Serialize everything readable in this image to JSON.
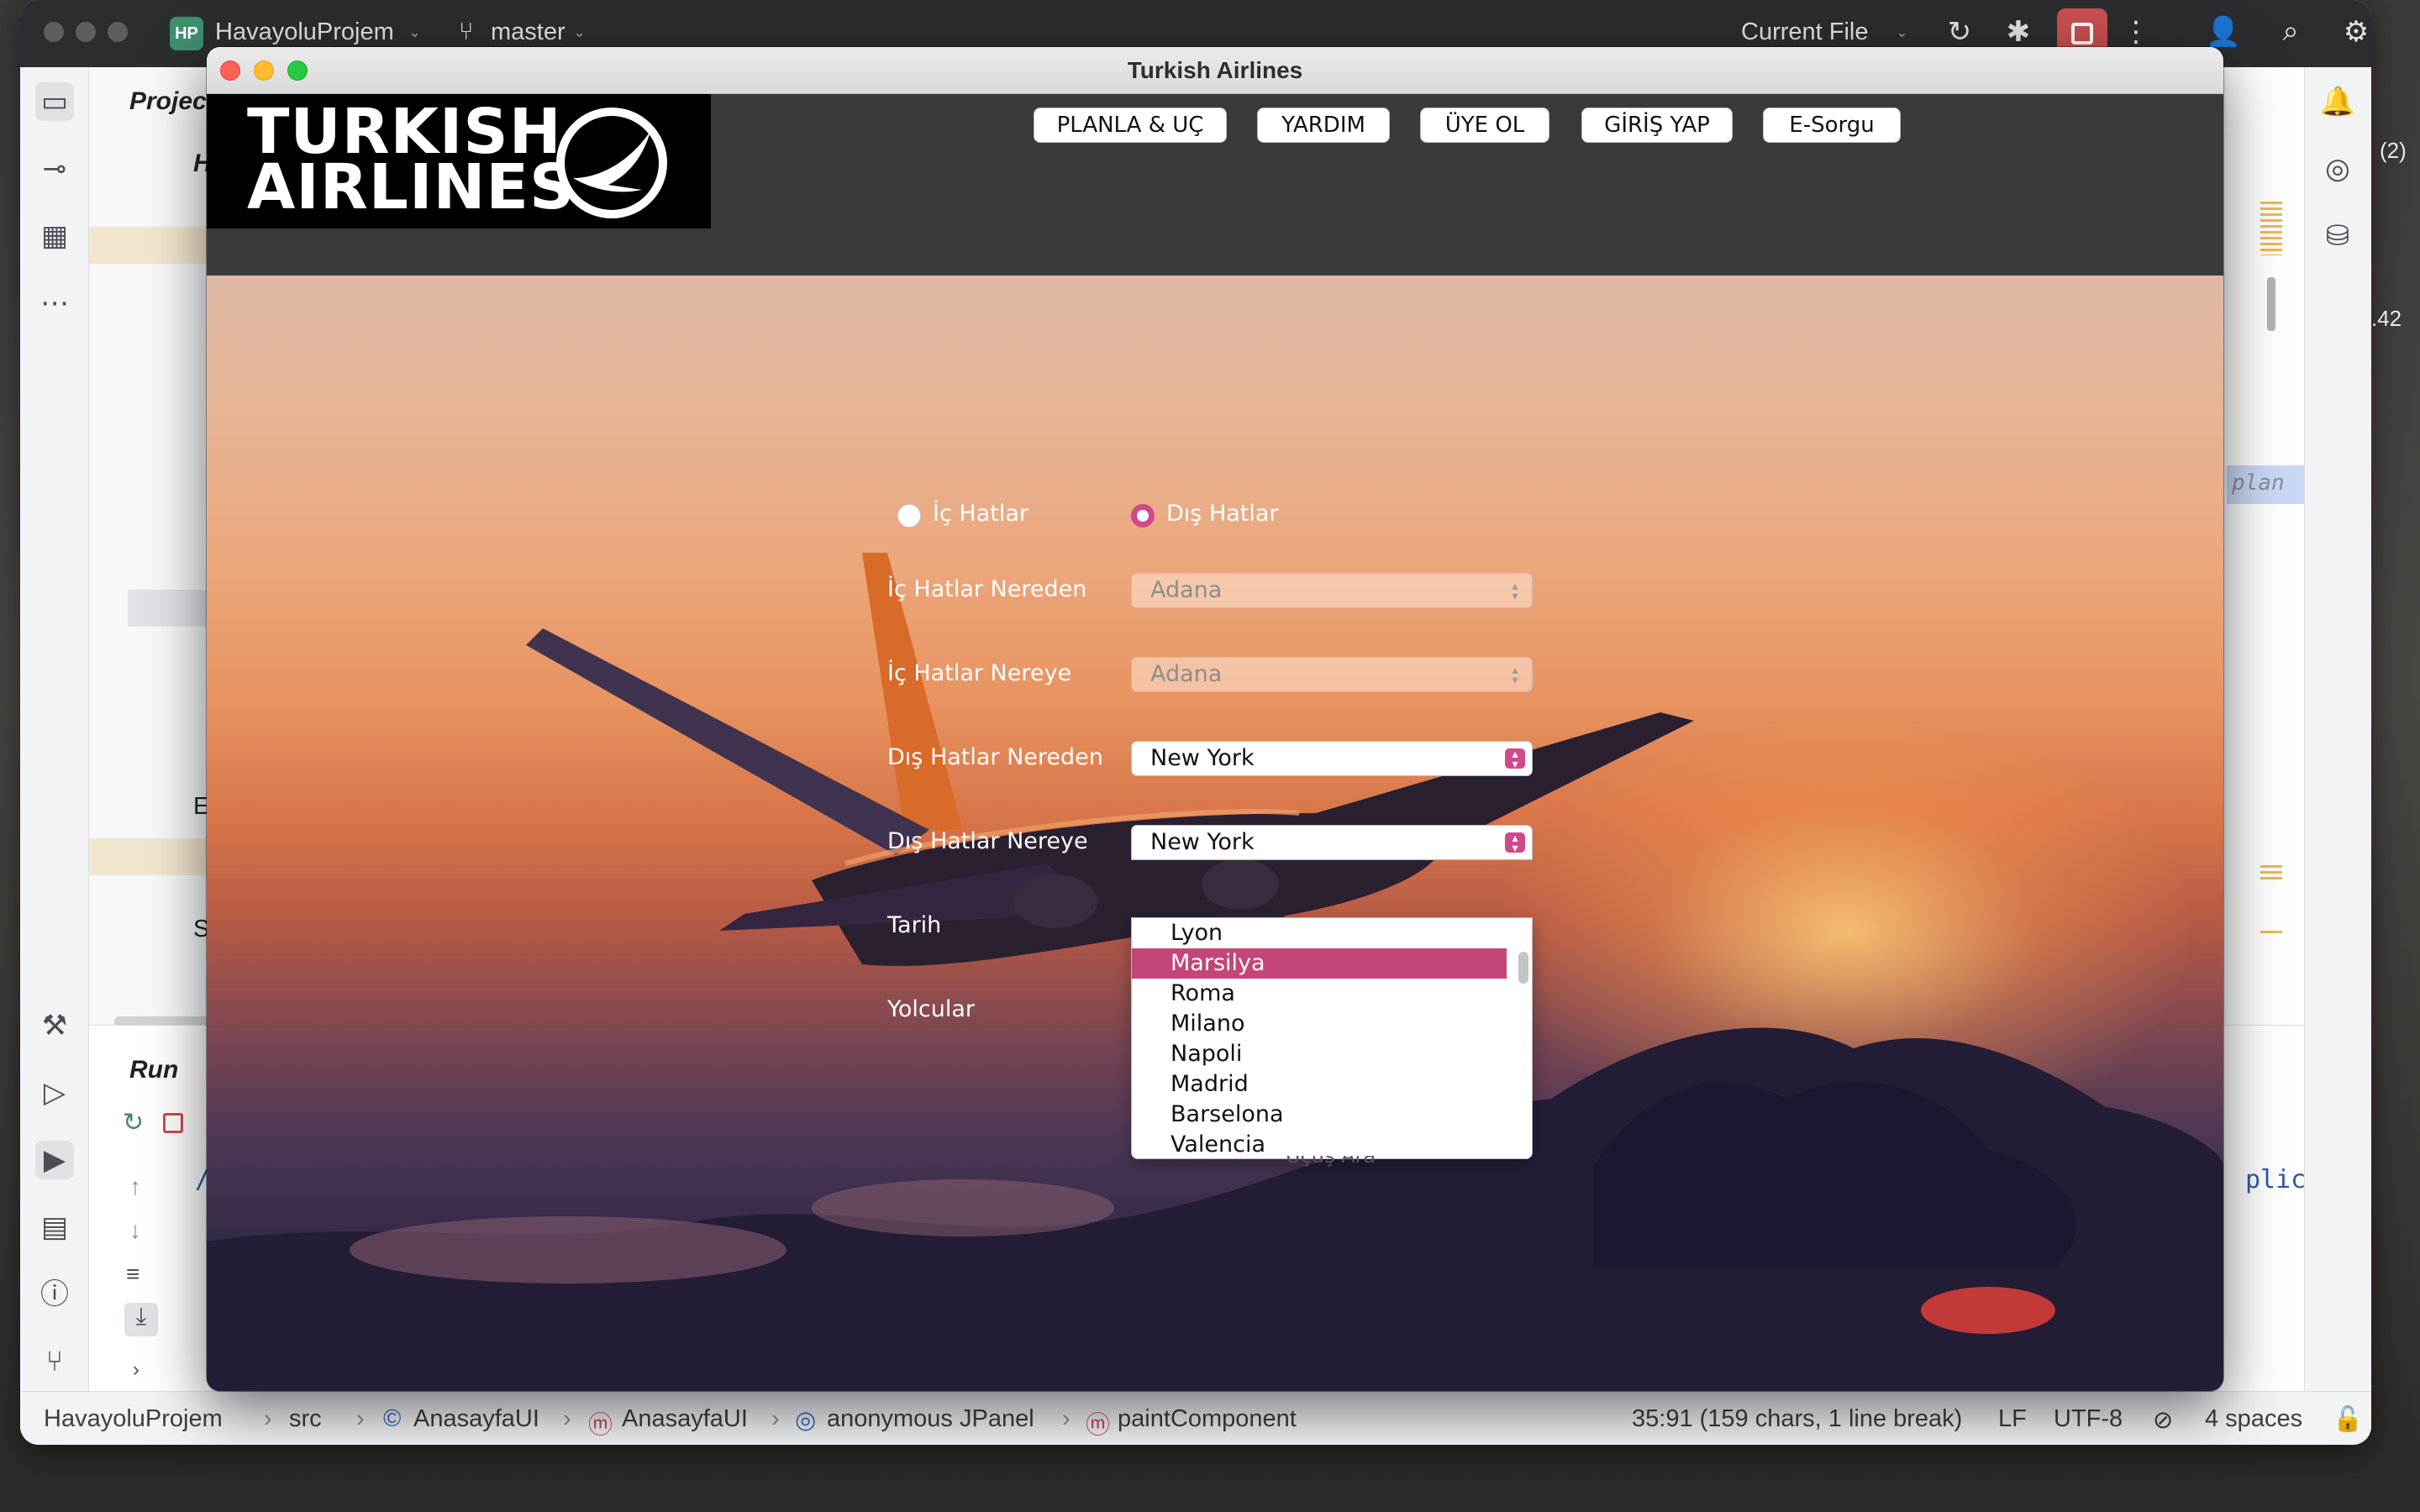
{
  "ide": {
    "project_badge": "HP",
    "project_name": "HavayoluProjem",
    "branch": "master",
    "run_config": "Current File",
    "project_tab": "Project",
    "run_tab": "Run",
    "console_line": "/Li",
    "console_line_right": "plic",
    "editor_hint": "plan",
    "tree_badge": "(2)",
    "tree_number": ".42",
    "tree_ext": "Ext",
    "tree_sc": "Sc",
    "tree_ha": "Ha"
  },
  "status_bar": {
    "breadcrumbs": [
      "HavayoluProjem",
      "src",
      "AnasayfaUI",
      "AnasayfaUI",
      "anonymous JPanel",
      "paintComponent"
    ],
    "position": "35:91 (159 chars, 1 line break)",
    "line_ending": "LF",
    "encoding": "UTF-8",
    "indent": "4 spaces"
  },
  "app": {
    "window_title": "Turkish Airlines",
    "logo_text": "TURKISH\nAIRLINES",
    "nav": [
      "PLANLA & UÇ",
      "YARDIM",
      "ÜYE OL",
      "GİRİŞ YAP",
      "E-Sorgu"
    ],
    "radios": [
      {
        "label": "İç Hatlar",
        "selected": false
      },
      {
        "label": "Dış Hatlar",
        "selected": true
      }
    ],
    "fields": {
      "ic_nereden": {
        "label": "İç Hatlar Nereden",
        "value": "Adana"
      },
      "ic_nereye": {
        "label": "İç Hatlar Nereye",
        "value": "Adana"
      },
      "dis_nereden": {
        "label": "Dış Hatlar Nereden",
        "value": "New York"
      },
      "dis_nereye": {
        "label": "Dış Hatlar Nereye",
        "value": "New York"
      },
      "tarih": {
        "label": "Tarih"
      },
      "yolcular": {
        "label": "Yolcular"
      }
    },
    "dropdown_options": [
      "Lyon",
      "Marsilya",
      "Roma",
      "Milano",
      "Napoli",
      "Madrid",
      "Barselona",
      "Valencia"
    ],
    "dropdown_selected": "Marsilya",
    "hidden_button": "Uçuş Ara"
  },
  "colors": {
    "accent": "#d04a8a",
    "selection": "#c44678",
    "header_bg": "#3a3a3a"
  }
}
